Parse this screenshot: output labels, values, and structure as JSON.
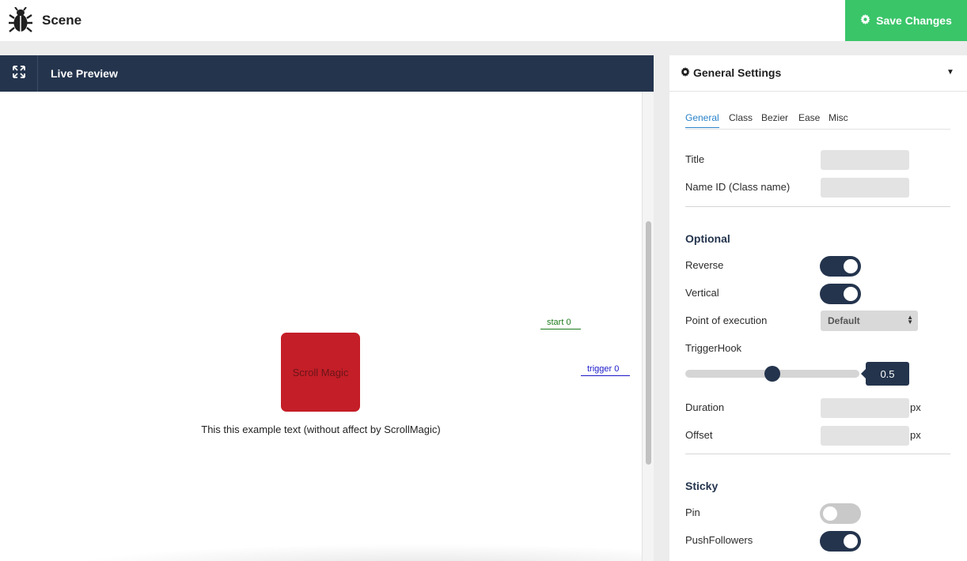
{
  "app": {
    "title": "Scene",
    "icon": "bug-icon",
    "save_label": "Save Changes",
    "save_icon": "gear-icon",
    "colors": {
      "save": "#3ac569",
      "header": "#24344d",
      "active_tab": "#2a83c9",
      "scroll_box": "#c41e28"
    }
  },
  "preview": {
    "expand_icon": "expand-icon",
    "title": "Live Preview",
    "start_marker": "start 0",
    "trigger_marker": "trigger 0",
    "box_label": "Scroll Magic",
    "example_text": "This this example text (without affect by ScrollMagic)"
  },
  "settings": {
    "title": "General Settings",
    "title_icon": "gear-icon",
    "collapse_icon": "caret-down-icon",
    "tabs": [
      "General",
      "Class",
      "Bezier",
      "Ease",
      "Misc"
    ],
    "active_tab": "General",
    "fields": {
      "title_label": "Title",
      "title_value": "",
      "name_id_label": "Name ID (Class name)",
      "name_id_value": ""
    },
    "optional": {
      "heading": "Optional",
      "reverse_label": "Reverse",
      "reverse_on": true,
      "vertical_label": "Vertical",
      "vertical_on": true,
      "point_label": "Point of execution",
      "point_value": "Default",
      "trigger_hook_label": "TriggerHook",
      "trigger_hook_value": "0.5",
      "duration_label": "Duration",
      "duration_value": "",
      "duration_unit": "px",
      "offset_label": "Offset",
      "offset_value": "",
      "offset_unit": "px"
    },
    "sticky": {
      "heading": "Sticky",
      "pin_label": "Pin",
      "pin_on": false,
      "push_followers_label": "PushFollowers",
      "push_followers_on": true
    }
  }
}
